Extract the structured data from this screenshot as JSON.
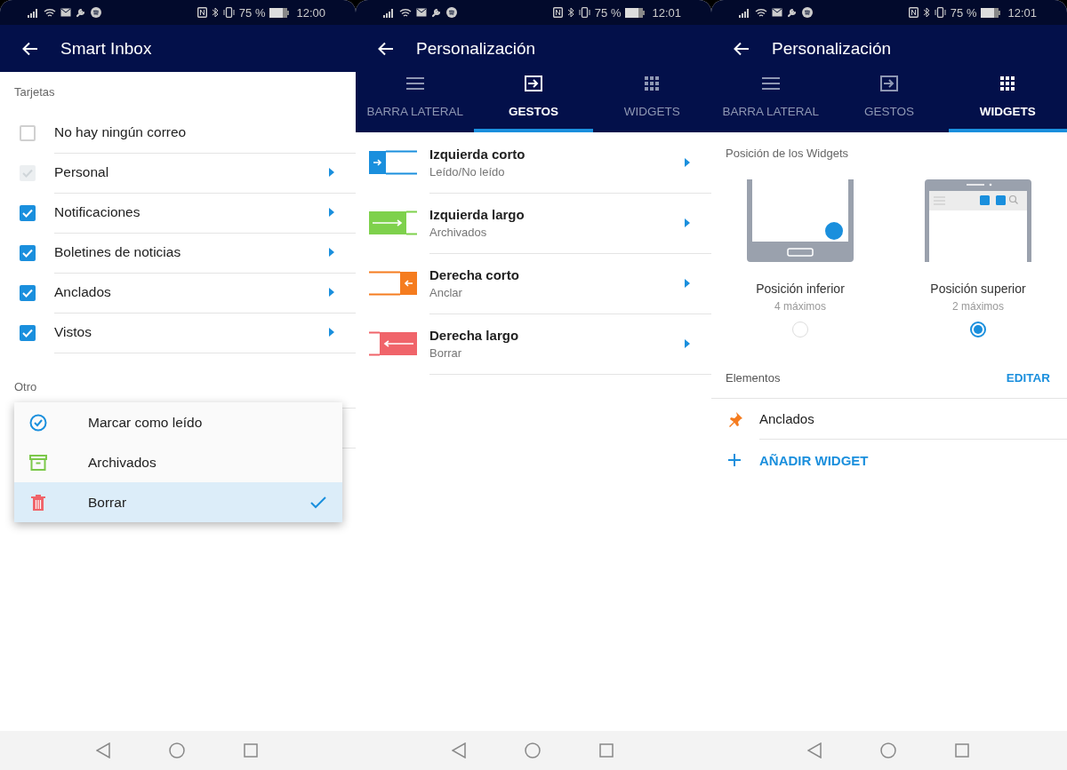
{
  "screens": [
    {
      "kind": "cards",
      "status_bar": {
        "battery": "75 %",
        "time": "12:00"
      },
      "app_bar": {
        "title": "Smart Inbox"
      },
      "sections": [
        {
          "title": "Tarjetas",
          "items": [
            {
              "label": "No hay ningún correo",
              "checked": false,
              "disabled": false,
              "submenu": false
            },
            {
              "label": "Personal",
              "checked": true,
              "disabled": true,
              "submenu": true
            },
            {
              "label": "Notificaciones",
              "checked": true,
              "disabled": false,
              "submenu": true
            },
            {
              "label": "Boletines de noticias",
              "checked": true,
              "disabled": false,
              "submenu": true
            },
            {
              "label": "Anclados",
              "checked": true,
              "disabled": false,
              "submenu": true
            },
            {
              "label": "Vistos",
              "checked": true,
              "disabled": false,
              "submenu": true
            }
          ]
        },
        {
          "title": "Otro"
        }
      ],
      "menu": {
        "items": [
          {
            "label": "Marcar como leído",
            "kind": "read",
            "color": "#1a8fdd",
            "selected": false
          },
          {
            "label": "Archivados",
            "kind": "archive",
            "color": "#7cc84a",
            "selected": false
          },
          {
            "label": "Borrar",
            "kind": "trash",
            "color": "#f0646a",
            "selected": true
          }
        ]
      }
    },
    {
      "kind": "gestures",
      "status_bar": {
        "battery": "75 %",
        "time": "12:01"
      },
      "app_bar": {
        "title": "Personalización"
      },
      "tabs": [
        {
          "label": "BARRA LATERAL",
          "kind": "menu",
          "selected": false
        },
        {
          "label": "GESTOS",
          "kind": "gesture",
          "selected": true
        },
        {
          "label": "WIDGETS",
          "kind": "grid",
          "selected": false
        }
      ],
      "gestures": [
        {
          "title": "Izquierda corto",
          "subtitle": "Leído/No leído",
          "kind": "left-short",
          "color": "#1a8fdd"
        },
        {
          "title": "Izquierda largo",
          "subtitle": "Archivados",
          "kind": "left-long",
          "color": "#7ed14c"
        },
        {
          "title": "Derecha corto",
          "subtitle": "Anclar",
          "kind": "right-short",
          "color": "#f57c1f"
        },
        {
          "title": "Derecha largo",
          "subtitle": "Borrar",
          "kind": "right-long",
          "color": "#f0646a"
        }
      ]
    },
    {
      "kind": "widgets",
      "status_bar": {
        "battery": "75 %",
        "time": "12:01"
      },
      "app_bar": {
        "title": "Personalización"
      },
      "tabs": [
        {
          "label": "BARRA LATERAL",
          "kind": "menu",
          "selected": false
        },
        {
          "label": "GESTOS",
          "kind": "gesture",
          "selected": false
        },
        {
          "label": "WIDGETS",
          "kind": "grid",
          "selected": true
        }
      ],
      "position": {
        "title": "Posición de los Widgets",
        "options": [
          {
            "kind": "bottom",
            "label": "Posición inferior",
            "sublabel": "4 máximos",
            "selected": false
          },
          {
            "kind": "top",
            "label": "Posición superior",
            "sublabel": "2 máximos",
            "selected": true
          }
        ]
      },
      "elements": {
        "title": "Elementos",
        "action": "EDITAR",
        "items": [
          {
            "label": "Anclados"
          }
        ],
        "add": "AÑADIR WIDGET"
      }
    }
  ]
}
